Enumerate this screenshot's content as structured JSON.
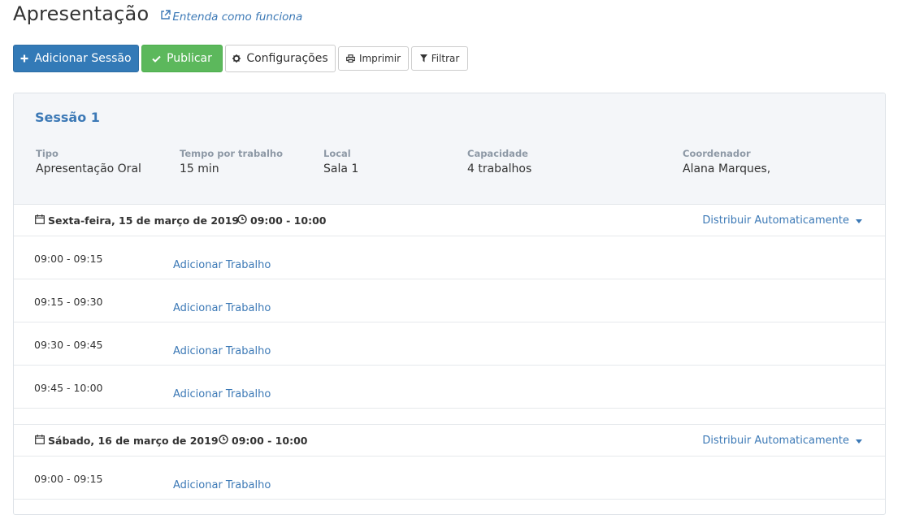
{
  "header": {
    "title": "Apresentação",
    "help_link": "Entenda como funciona",
    "help_icon": "external-link-icon"
  },
  "toolbar": {
    "add_session": "Adicionar Sessão",
    "publish": "Publicar",
    "settings": "Configurações",
    "print": "Imprimir",
    "filter": "Filtrar"
  },
  "colors": {
    "primary": "#337ab7",
    "success": "#5cb85c",
    "link": "#3c79b6",
    "panel_bg": "#f4f6f9",
    "label": "#8e99a6"
  },
  "session": {
    "title": "Sessão 1",
    "fields": [
      {
        "label": "Tipo",
        "value": "Apresentação Oral"
      },
      {
        "label": "Tempo por trabalho",
        "value": "15 min"
      },
      {
        "label": "Local",
        "value": "Sala 1"
      },
      {
        "label": "Capacidade",
        "value": "4 trabalhos"
      },
      {
        "label": "Coordenador",
        "value": "Alana Marques,"
      }
    ]
  },
  "days": [
    {
      "date": "Sexta-feira, 15 de março de 2019",
      "time": "09:00 - 10:00",
      "distribute": "Distribuir Automaticamente",
      "slots": [
        {
          "time": "09:00 - 09:15",
          "action": "Adicionar Trabalho"
        },
        {
          "time": "09:15 - 09:30",
          "action": "Adicionar Trabalho"
        },
        {
          "time": "09:30 - 09:45",
          "action": "Adicionar Trabalho"
        },
        {
          "time": "09:45 - 10:00",
          "action": "Adicionar Trabalho"
        }
      ]
    },
    {
      "date": "Sábado, 16 de março de 2019",
      "time": "09:00 - 10:00",
      "distribute": "Distribuir Automaticamente",
      "slots": [
        {
          "time": "09:00 - 09:15",
          "action": "Adicionar Trabalho"
        }
      ]
    }
  ]
}
